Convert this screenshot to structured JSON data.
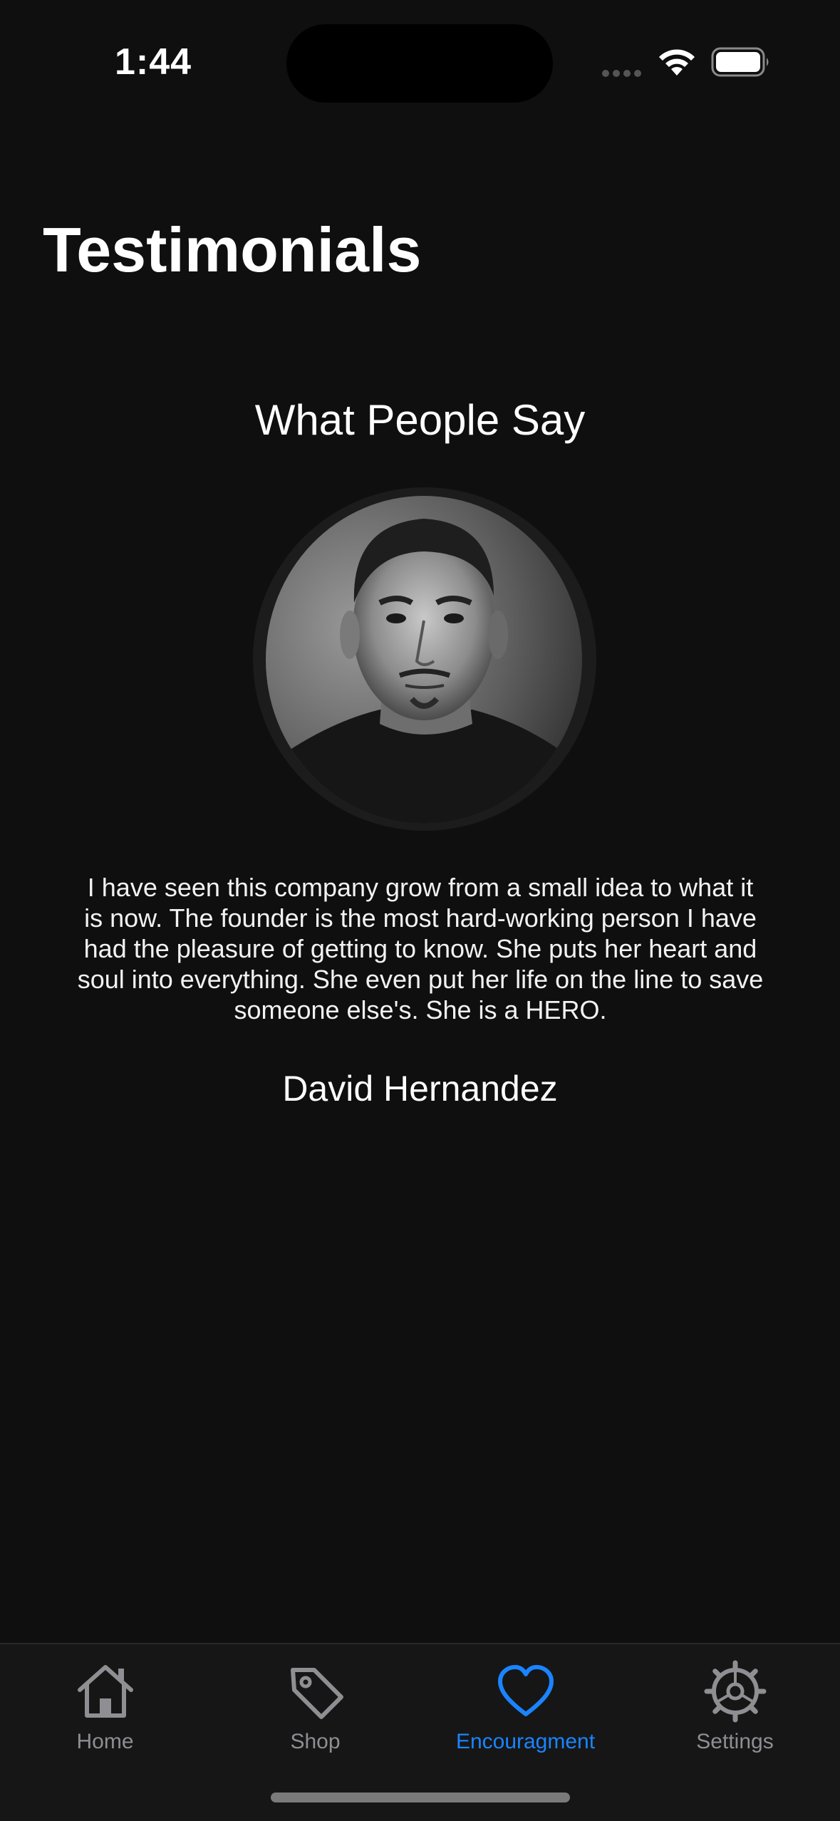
{
  "status_bar": {
    "time": "1:44",
    "wifi_icon": "wifi-icon",
    "battery_icon": "battery-icon"
  },
  "page": {
    "title": "Testimonials"
  },
  "testimonial": {
    "heading": "What People Say",
    "avatar_icon": "portrait-photo",
    "quote": "I have seen this company grow from a small idea to what it is now. The founder is the most hard-working person I have had the pleasure of getting to know. She puts her heart and soul into everything. She even put her life on the line to save someone else's. She is a HERO.",
    "author": "David Hernandez"
  },
  "tab_bar": {
    "active_index": 2,
    "active_color": "#1a84ff",
    "inactive_color": "#8e8e93",
    "tabs": [
      {
        "label": "Home",
        "icon": "house-icon"
      },
      {
        "label": "Shop",
        "icon": "tag-icon"
      },
      {
        "label": "Encouragment",
        "icon": "heart-icon"
      },
      {
        "label": "Settings",
        "icon": "gear-icon"
      }
    ]
  }
}
